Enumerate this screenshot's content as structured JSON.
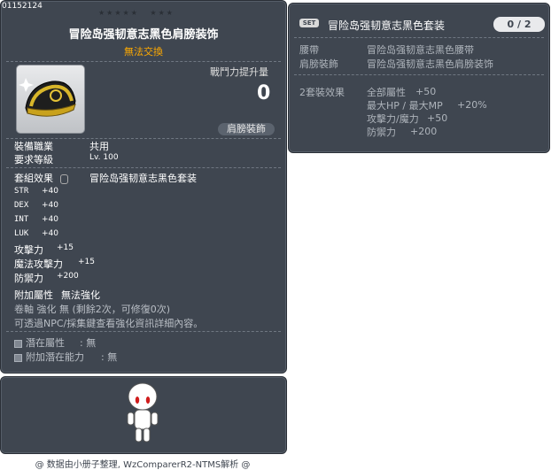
{
  "item": {
    "id": "01152124",
    "stars": [
      "★★★★★",
      "★★★"
    ],
    "title": "冒险岛强韧意志黑色肩膀装饰",
    "untradable": "無法交換",
    "power_label": "戰鬥力提升量",
    "power_value": "0",
    "slot_tag": "肩膀裝飾",
    "icon": "shoulder-armor-icon",
    "job_label": "裝備職業",
    "job_value": "共用",
    "level_label": "要求等級",
    "level_value": "Lv. 100",
    "set_label": "套組效果",
    "set_name": "冒险岛强韧意志黑色套装",
    "stats": [
      {
        "name": "STR",
        "value": "+40"
      },
      {
        "name": "DEX",
        "value": "+40"
      },
      {
        "name": "INT",
        "value": "+40"
      },
      {
        "name": "LUK",
        "value": "+40"
      },
      {
        "name": "攻擊力",
        "value": "+15"
      },
      {
        "name": "魔法攻擊力",
        "value": "+15"
      },
      {
        "name": "防禦力",
        "value": "+200"
      }
    ],
    "extra_label": "附加屬性",
    "extra_value": "無法強化",
    "scroll_line": "卷軸 強化 無 (剩餘2次，可修復0次)",
    "npc_line": "可透過NPC/採集鍵查看強化資訊詳細內容。",
    "potential_label": "潛在屬性",
    "potential_value": "無",
    "add_potential_label": "附加潛在能力",
    "add_potential_value": "無"
  },
  "set": {
    "badge": "SET",
    "name": "冒险岛强韧意志黑色套装",
    "count": "0 / 2",
    "parts": [
      {
        "slot": "腰帶",
        "name": "冒险岛强韧意志黑色腰带"
      },
      {
        "slot": "肩膀裝飾",
        "name": "冒险岛强韧意志黑色肩膀装饰"
      }
    ],
    "effect_label": "2套裝效果",
    "effects": [
      {
        "name": "全部屬性",
        "value": "+50"
      },
      {
        "name": "最大HP / 最大MP",
        "value": "+20%"
      },
      {
        "name": "攻擊力/魔力",
        "value": "+50"
      },
      {
        "name": "防禦力",
        "value": "+200"
      }
    ]
  },
  "footer": "@ 数据由小册子整理, WzComparerR2-NTMS解析 @"
}
